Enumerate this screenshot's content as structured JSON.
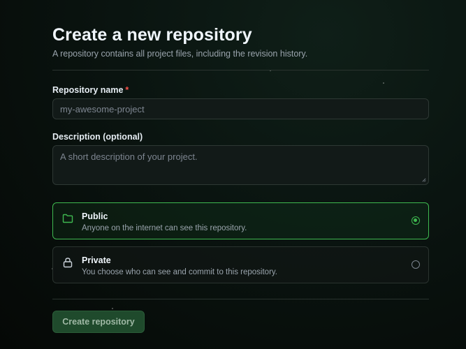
{
  "page": {
    "title": "Create a new repository",
    "subtitle": "A repository contains all project files, including the revision history."
  },
  "form": {
    "name": {
      "label": "Repository name",
      "required_marker": "*",
      "placeholder": "my-awesome-project",
      "value": ""
    },
    "description": {
      "label": "Description (optional)",
      "placeholder": "A short description of your project.",
      "value": ""
    },
    "visibility": {
      "selected": "public",
      "options": [
        {
          "id": "public",
          "icon": "folder-icon",
          "title": "Public",
          "description": "Anyone on the internet can see this repository."
        },
        {
          "id": "private",
          "icon": "lock-icon",
          "title": "Private",
          "description": "You choose who can see and commit to this repository."
        }
      ]
    },
    "submit_label": "Create repository"
  },
  "colors": {
    "accent": "#3fb950",
    "required": "#f85149",
    "button_bg": "#1f4a2c"
  }
}
